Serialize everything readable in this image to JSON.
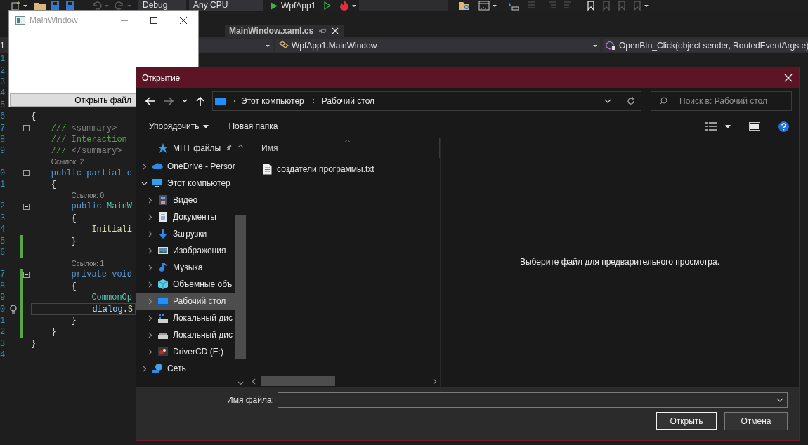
{
  "toolbar": {
    "configuration": "Debug",
    "platform": "Any CPU",
    "start_label": "WpfApp1"
  },
  "main_window": {
    "title": "MainWindow",
    "button": "Открыть файл"
  },
  "editor_tab": {
    "title": "MainWindow.xaml.cs"
  },
  "nav_bar": {
    "project": "1",
    "type": "WpfApp1.MainWindow",
    "member": "OpenBtn_Click(object sender, RoutedEventArgs e)"
  },
  "code_lines": [
    {
      "kind": "code",
      "number": "1",
      "fold": false,
      "changed": false,
      "current": false
    },
    {
      "kind": "code",
      "number": "2",
      "fold": false,
      "changed": false,
      "current": false
    },
    {
      "kind": "code",
      "number": "3",
      "fold": false,
      "changed": false,
      "current": false
    },
    {
      "kind": "code",
      "number": "4",
      "fold": false,
      "changed": false,
      "current": false
    },
    {
      "kind": "code",
      "number": "5",
      "fold": false,
      "changed": false,
      "current": false
    },
    {
      "kind": "code",
      "number": "6",
      "fold": false,
      "changed": false,
      "current": false,
      "tokens": [
        {
          "text": "{",
          "kind": "punct"
        }
      ]
    },
    {
      "kind": "code",
      "number": "7",
      "fold": true,
      "changed": false,
      "current": false,
      "tokens": [
        {
          "text": "    ///",
          "kind": "comment"
        },
        {
          "text": " <summary>",
          "kind": "doc"
        }
      ]
    },
    {
      "kind": "code",
      "number": "8",
      "fold": false,
      "changed": false,
      "current": false,
      "tokens": [
        {
          "text": "    /// Interaction",
          "kind": "comment"
        }
      ]
    },
    {
      "kind": "code",
      "number": "9",
      "fold": false,
      "changed": false,
      "current": false,
      "tokens": [
        {
          "text": "    ///",
          "kind": "comment"
        },
        {
          "text": " </summary>",
          "kind": "doc"
        }
      ]
    },
    {
      "kind": "lens",
      "text": "Ссылок: 2"
    },
    {
      "kind": "code",
      "number": "0",
      "fold": true,
      "changed": false,
      "current": false,
      "tokens": [
        {
          "text": "    public partial c",
          "kind": "keyword"
        }
      ]
    },
    {
      "kind": "code",
      "number": "1",
      "fold": false,
      "changed": false,
      "current": false,
      "tokens": [
        {
          "text": "    {",
          "kind": "punct"
        }
      ]
    },
    {
      "kind": "lens",
      "text": "Ссылок: 0"
    },
    {
      "kind": "code",
      "number": "2",
      "fold": true,
      "changed": false,
      "current": false,
      "tokens": [
        {
          "text": "        public",
          "kind": "keyword"
        },
        {
          "text": " MainW",
          "kind": "type"
        }
      ]
    },
    {
      "kind": "code",
      "number": "3",
      "fold": false,
      "changed": false,
      "current": false,
      "tokens": [
        {
          "text": "        {",
          "kind": "punct"
        }
      ]
    },
    {
      "kind": "code",
      "number": "4",
      "fold": false,
      "changed": false,
      "current": false,
      "tokens": [
        {
          "text": "            Initiali",
          "kind": "method"
        }
      ]
    },
    {
      "kind": "code",
      "number": "5",
      "fold": false,
      "changed": true,
      "current": false,
      "tokens": [
        {
          "text": "        }",
          "kind": "punct"
        }
      ]
    },
    {
      "kind": "code",
      "number": "6",
      "fold": false,
      "changed": true,
      "current": false
    },
    {
      "kind": "lens",
      "text": "Ссылок: 1"
    },
    {
      "kind": "code",
      "number": "7",
      "fold": true,
      "changed": true,
      "current": false,
      "tokens": [
        {
          "text": "        private void",
          "kind": "keyword"
        }
      ]
    },
    {
      "kind": "code",
      "number": "8",
      "fold": false,
      "changed": true,
      "current": false,
      "tokens": [
        {
          "text": "        {",
          "kind": "punct"
        }
      ]
    },
    {
      "kind": "code",
      "number": "9",
      "fold": false,
      "changed": true,
      "current": false,
      "tokens": [
        {
          "text": "            CommonOp",
          "kind": "type"
        }
      ]
    },
    {
      "kind": "code",
      "number": "0",
      "fold": false,
      "changed": true,
      "current": true,
      "tokens": [
        {
          "text": "            dialog",
          "kind": "variable"
        },
        {
          "text": ".",
          "kind": "punct"
        },
        {
          "text": "S",
          "kind": "method"
        }
      ]
    },
    {
      "kind": "code",
      "number": "1",
      "fold": false,
      "changed": true,
      "current": false,
      "tokens": [
        {
          "text": "        }",
          "kind": "punct"
        }
      ]
    },
    {
      "kind": "code",
      "number": "2",
      "fold": false,
      "changed": true,
      "current": false,
      "tokens": [
        {
          "text": "    }",
          "kind": "punct"
        }
      ]
    },
    {
      "kind": "code",
      "number": "3",
      "fold": false,
      "changed": false,
      "current": false,
      "tokens": [
        {
          "text": "}",
          "kind": "punct"
        }
      ]
    },
    {
      "kind": "code",
      "number": "4",
      "fold": false,
      "changed": false,
      "current": false
    }
  ],
  "dialog": {
    "title": "Открытие",
    "breadcrumb": [
      "Этот компьютер",
      "Рабочий стол"
    ],
    "search": {
      "placeholder": "Поиск в: Рабочий стол"
    },
    "commands": {
      "organize": "Упорядочить",
      "new_folder": "Новая папка"
    },
    "nav_tree": [
      {
        "label": "МПТ файлы",
        "kind": "pinned",
        "selected": false
      },
      {
        "label": "OneDrive - Persor",
        "kind": "cloud",
        "selected": false,
        "expanded": false
      },
      {
        "label": "Этот компьютер",
        "kind": "pc",
        "selected": false,
        "expanded": true,
        "children": [
          {
            "label": "Видео",
            "kind": "video",
            "selected": false,
            "expanded": false
          },
          {
            "label": "Документы",
            "kind": "documents",
            "selected": false,
            "expanded": false
          },
          {
            "label": "Загрузки",
            "kind": "downloads",
            "selected": false,
            "expanded": false
          },
          {
            "label": "Изображения",
            "kind": "pictures",
            "selected": false,
            "expanded": false
          },
          {
            "label": "Музыка",
            "kind": "music",
            "selected": false,
            "expanded": false
          },
          {
            "label": "Объемные объ",
            "kind": "objects",
            "selected": false,
            "expanded": false
          },
          {
            "label": "Рабочий стол",
            "kind": "desktop",
            "selected": true,
            "expanded": false
          },
          {
            "label": "Локальный дис",
            "kind": "system-disk",
            "selected": false,
            "expanded": false
          },
          {
            "label": "Локальный дис",
            "kind": "disk",
            "selected": false,
            "expanded": false
          },
          {
            "label": "DriverCD (E:)",
            "kind": "cd",
            "selected": false,
            "expanded": false
          }
        ]
      },
      {
        "label": "Сеть",
        "kind": "network",
        "selected": false,
        "expanded": false
      }
    ],
    "file_list": {
      "column": "Имя",
      "files": [
        "создатели программы.txt"
      ]
    },
    "preview_message": "Выберите файл для предварительного просмотра.",
    "file_name_label": "Имя файла:",
    "buttons": {
      "open": "Открыть",
      "cancel": "Отмена"
    }
  }
}
